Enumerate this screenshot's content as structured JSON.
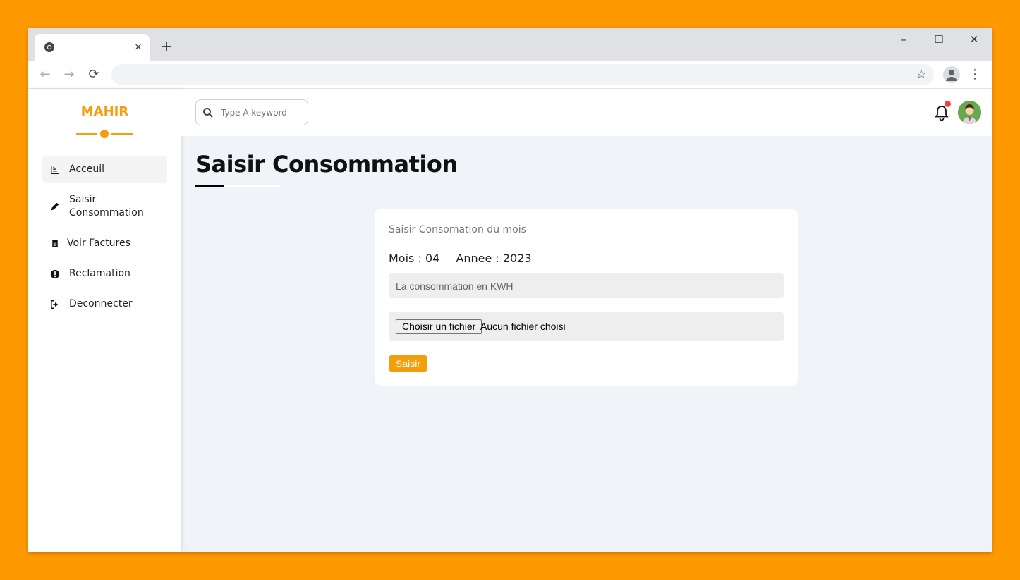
{
  "browser": {
    "tab_close": "×",
    "new_tab": "+",
    "window_controls": {
      "minimize": "–",
      "maximize": "☐",
      "close": "✕"
    },
    "nav": {
      "back": "←",
      "forward": "→",
      "reload": "⟳"
    },
    "star": "☆",
    "menu": "⋮"
  },
  "sidebar": {
    "logo": "MAHIR",
    "accent_color": "#f59e0b",
    "items": [
      {
        "label": "Acceuil",
        "icon": "chart-icon",
        "active": true
      },
      {
        "label": "Saisir Consommation",
        "icon": "pencil-icon",
        "active": false
      },
      {
        "label": "Voir Factures",
        "icon": "receipt-icon",
        "active": false
      },
      {
        "label": "Reclamation",
        "icon": "exclamation-icon",
        "active": false
      },
      {
        "label": "Deconnecter",
        "icon": "sign-out-icon",
        "active": false
      }
    ]
  },
  "header": {
    "search_placeholder": "Type A keyword",
    "notification_dot_color": "#f44336"
  },
  "page": {
    "title": "Saisir Consommation"
  },
  "form": {
    "title": "Saisir Consomation du mois",
    "month_label": "Mois : 04",
    "year_label": "Annee : 2023",
    "consumption_placeholder": "La consommation en KWH",
    "file_button": "Choisir un fichier",
    "file_status": "Aucun fichier choisi",
    "submit_label": "Saisir"
  }
}
